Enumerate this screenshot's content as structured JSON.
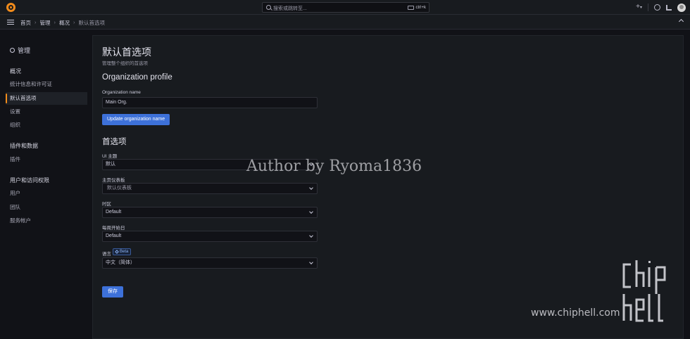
{
  "topbar": {
    "search_placeholder": "搜索或跳转至...",
    "shortcut": "ctrl+k",
    "add_label": "+"
  },
  "breadcrumb": {
    "items": [
      "首页",
      "管理",
      "概况",
      "默认首选项"
    ]
  },
  "sidebar": {
    "title": "管理",
    "groups": [
      {
        "label": "概况",
        "items": [
          "统计信息和许可证",
          "默认首选项",
          "设置",
          "组织"
        ]
      },
      {
        "label": "插件和数据",
        "items": [
          "插件"
        ]
      },
      {
        "label": "用户和访问权限",
        "items": [
          "用户",
          "团队",
          "服务帐户"
        ]
      }
    ],
    "active_item": "默认首选项"
  },
  "main": {
    "title": "默认首选项",
    "subtitle": "管理整个组织的首选项",
    "org_profile": {
      "heading": "Organization profile",
      "name_label": "Organization name",
      "name_value": "Main Org.",
      "update_button": "Update organization name"
    },
    "preferences": {
      "heading": "首选项",
      "ui_theme_label": "UI 主题",
      "ui_theme_value": "默认",
      "home_dashboard_label": "主页仪表板",
      "home_dashboard_placeholder": "默认仪表板",
      "timezone_label": "时区",
      "timezone_value": "Default",
      "week_start_label": "每周开始日",
      "week_start_value": "Default",
      "language_label": "语言",
      "language_badge": "Beta",
      "language_value": "中文（简体）",
      "save_button": "保存"
    }
  },
  "watermarks": {
    "author": "Author by Ryoma1836",
    "site": "www.chiphell.com"
  },
  "colors": {
    "accent": "#f28c1b",
    "primary_button": "#3d71d9",
    "background": "#111217",
    "panel": "#181b1f"
  }
}
